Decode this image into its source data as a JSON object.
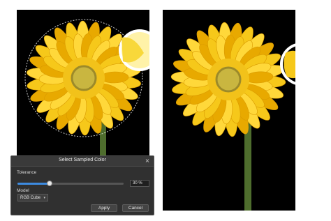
{
  "dialog": {
    "title": "Select Sampled Color",
    "close_glyph": "×",
    "tolerance_label": "Tolerance",
    "tolerance_level": 0.3,
    "tolerance_value": "30 %",
    "model_label": "Model",
    "model_selected": "RGB Cube",
    "model_caret": "▾",
    "apply_label": "Apply",
    "cancel_label": "Cancel"
  },
  "colors": {
    "petal": "#f6c81a",
    "petal_light": "#ffd83a",
    "petal_dark": "#e8a900",
    "center": "#c9b640",
    "center_ring": "#9c8a2a",
    "stem": "#4e6d2d",
    "selection": "#ffffff",
    "slider_accent": "#3d8be0"
  },
  "icons": {
    "close": "close-icon",
    "dropdown": "chevron-down-icon"
  }
}
